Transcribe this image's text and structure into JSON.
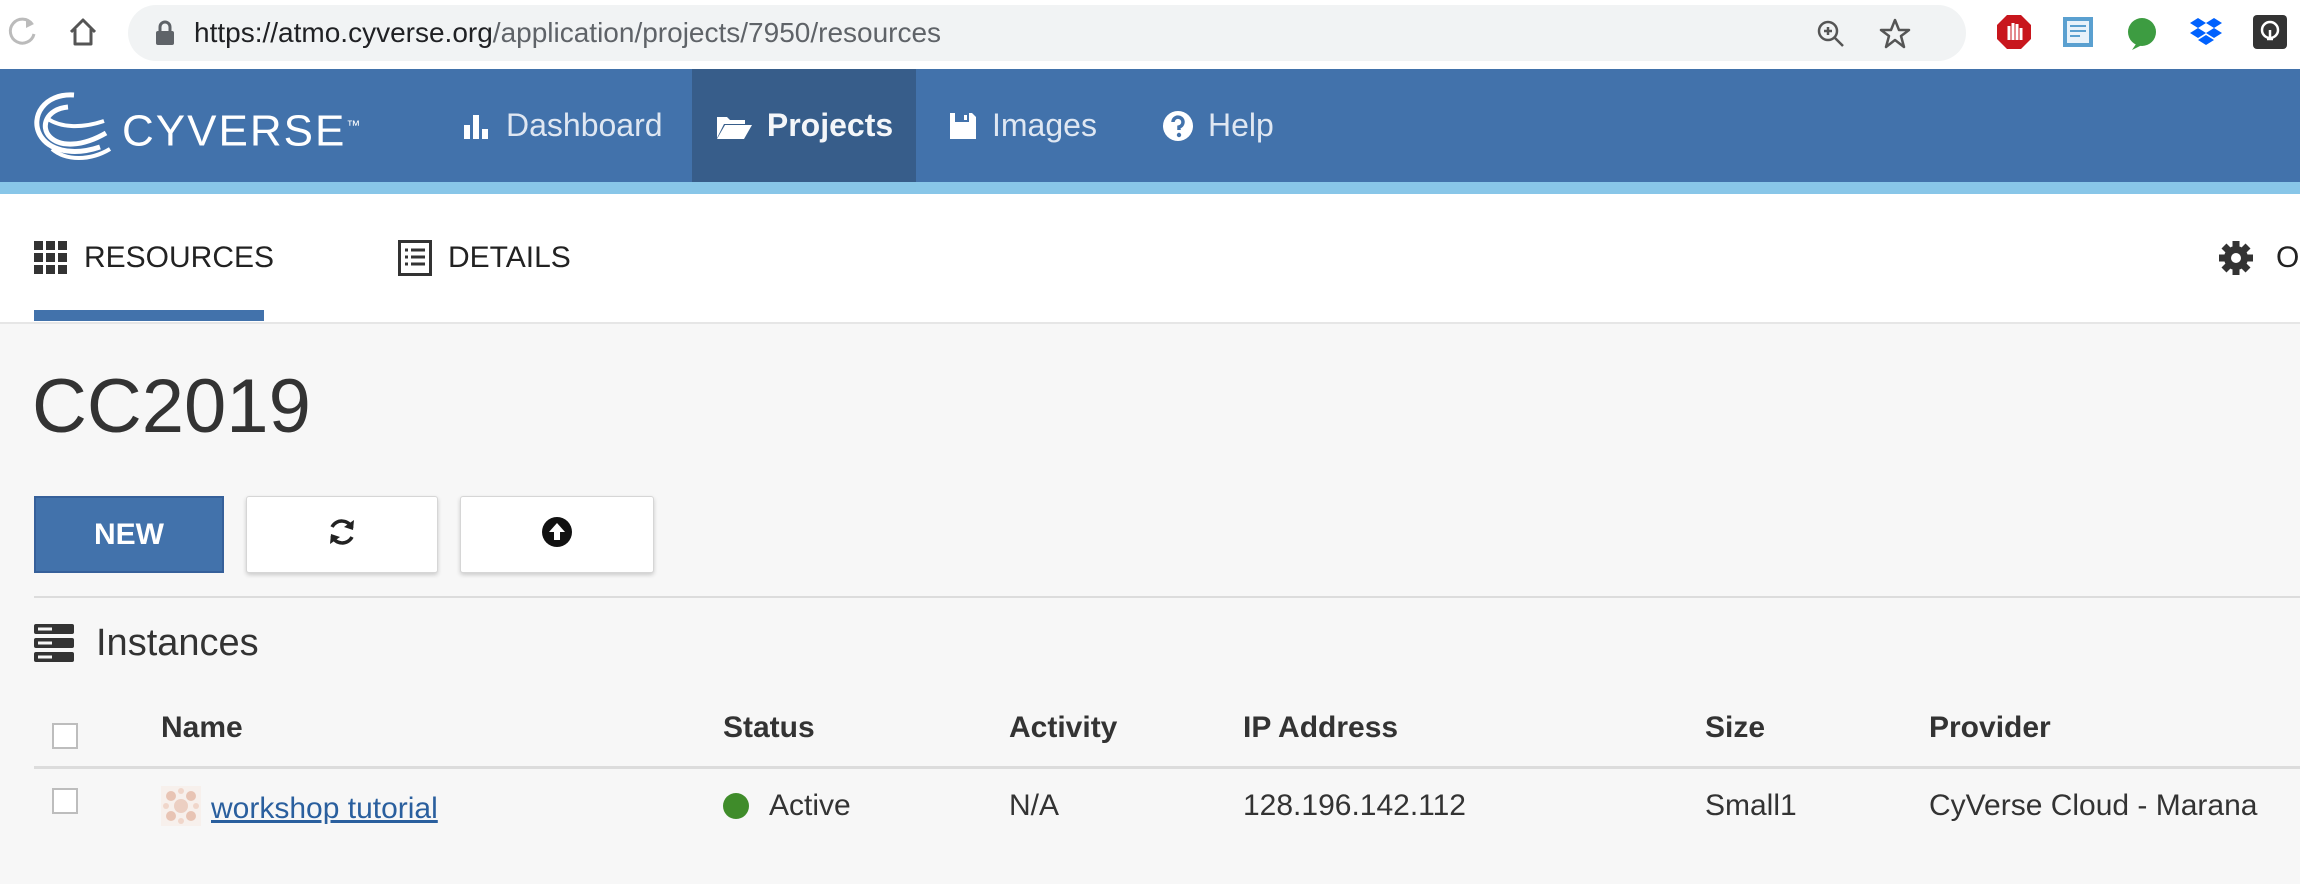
{
  "browser": {
    "url_host": "https://atmo.cyverse.org",
    "url_path": "/application/projects/7950/resources"
  },
  "app": {
    "logo_text": "CYVERSE",
    "trademark": "™"
  },
  "nav": {
    "items": [
      {
        "label": "Dashboard",
        "icon": "bar-chart-icon",
        "active": false
      },
      {
        "label": "Projects",
        "icon": "folder-open-icon",
        "active": true
      },
      {
        "label": "Images",
        "icon": "floppy-disk-icon",
        "active": false
      },
      {
        "label": "Help",
        "icon": "question-circle-icon",
        "active": false
      }
    ]
  },
  "subtabs": {
    "resources": "RESOURCES",
    "details": "DETAILS",
    "options_partial": "OI"
  },
  "project": {
    "title": "CC2019"
  },
  "toolbar": {
    "new_label": "NEW",
    "refresh_icon": "refresh-icon",
    "upload_icon": "upload-circle-icon"
  },
  "instances": {
    "title": "Instances",
    "columns": [
      "Name",
      "Status",
      "Activity",
      "IP Address",
      "Size",
      "Provider"
    ],
    "rows": [
      {
        "name": "workshop tutorial",
        "status": "Active",
        "activity": "N/A",
        "ip": "128.196.142.112",
        "size": "Small1",
        "provider": "CyVerse Cloud - Marana"
      }
    ]
  },
  "colors": {
    "navbar": "#4272ab",
    "navbar_active": "#375d8a",
    "stripe": "#88c6e8",
    "status_active": "#3f8c2a",
    "link": "#2a5f9e"
  }
}
